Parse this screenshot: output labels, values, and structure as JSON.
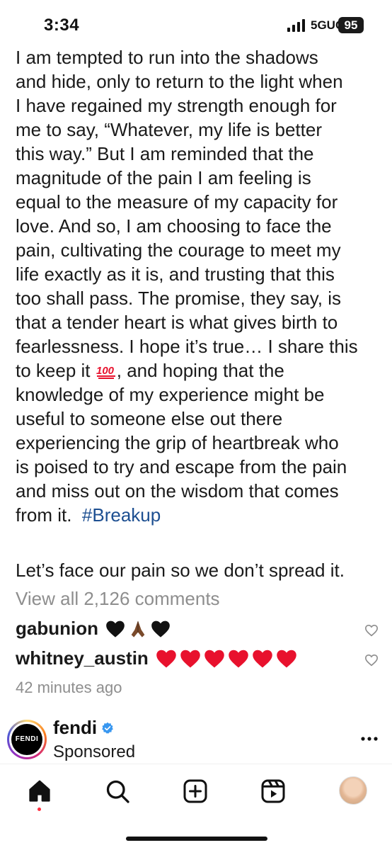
{
  "status_bar": {
    "time": "3:34",
    "network": "5GUC",
    "battery": "95"
  },
  "caption": {
    "lines": [
      "I am tempted to run into the shadows",
      "and hide, only to return to the light when",
      "I have regained my strength enough for",
      "me to say, “Whatever, my life is better",
      "this way.” But I am reminded that the",
      "magnitude of the pain I am feeling is",
      "equal to the measure of my capacity for",
      "love. And so, I am choosing to face the",
      "pain, cultivating the courage to meet my",
      "life exactly as it is, and trusting that this",
      "too shall pass. The promise, they say, is",
      "that a tender heart is what gives birth to",
      "fearlessness. I hope it’s true… I share this"
    ],
    "line_keep_prefix": "to keep it",
    "line_keep_suffix": ", and hoping that the",
    "lines_after": [
      "knowledge of my experience might be",
      "useful to someone else out there",
      "experiencing the grip of heartbreak who",
      "is poised to try and escape from the pain",
      "and miss out on the wisdom that comes"
    ],
    "last_line_text": "from it.",
    "hashtag": "#Breakup",
    "closing": "Let’s face our pain so we don’t spread it."
  },
  "comments_link": "View all 2,126 comments",
  "comments": [
    {
      "user": "gabunion",
      "emojis": [
        "black-heart",
        "folded-hands",
        "black-heart"
      ]
    },
    {
      "user": "whitney_austin",
      "emojis": [
        "red-heart",
        "red-heart",
        "red-heart",
        "red-heart",
        "red-heart",
        "red-heart"
      ]
    }
  ],
  "timestamp": "42 minutes ago",
  "sponsored_post": {
    "account": "fendi",
    "logo_text": "FENDI",
    "label": "Sponsored"
  },
  "colors": {
    "hashtag": "#1d4f91",
    "muted": "#8e8e8e",
    "heart_red": "#e8112d",
    "verified_blue": "#3897f0"
  },
  "icons": [
    "home-icon",
    "search-icon",
    "create-icon",
    "reels-icon",
    "profile-avatar",
    "more-icon",
    "verified-icon",
    "like-icon"
  ]
}
